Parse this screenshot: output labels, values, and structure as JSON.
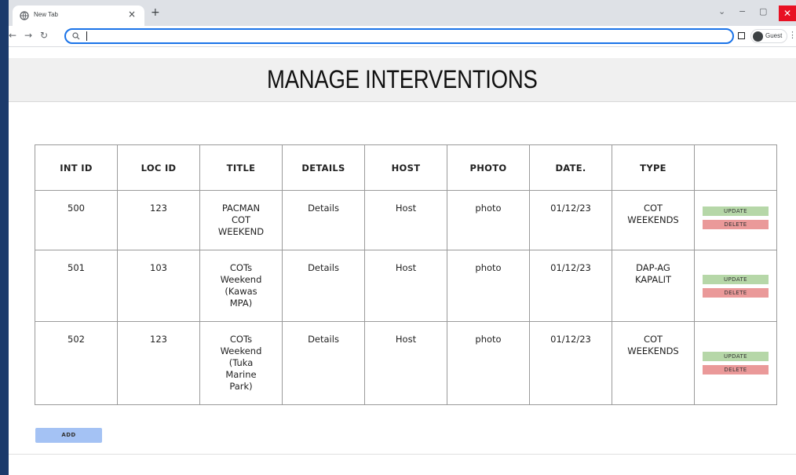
{
  "browser": {
    "tab_title": "New Tab",
    "profile_label": "Guest"
  },
  "page": {
    "title": "MANAGE INTERVENTIONS"
  },
  "table": {
    "headers": [
      "INT ID",
      "LOC ID",
      "TITLE",
      "DETAILS",
      "HOST",
      "PHOTO",
      "DATE.",
      "TYPE",
      ""
    ],
    "rows": [
      {
        "int_id": "500",
        "loc_id": "123",
        "title": "PACMAN COT WEEKEND",
        "details": "Details",
        "host": "Host",
        "photo": "photo",
        "date": "01/12/23",
        "type": "COT WEEKENDS"
      },
      {
        "int_id": "501",
        "loc_id": "103",
        "title": "COTs Weekend (Kawas MPA)",
        "details": "Details",
        "host": "Host",
        "photo": "photo",
        "date": "01/12/23",
        "type": "DAP-AG KAPALIT"
      },
      {
        "int_id": "502",
        "loc_id": "123",
        "title": "COTs Weekend (Tuka Marine Park)",
        "details": "Details",
        "host": "Host",
        "photo": "photo",
        "date": "01/12/23",
        "type": "COT WEEKENDS"
      }
    ],
    "update_label": "UPDATE",
    "delete_label": "DELETE"
  },
  "add_label": "ADD",
  "colors": {
    "update": "#b6d7a8",
    "delete": "#ea9999",
    "add": "#a4c2f4",
    "close": "#e81123"
  }
}
